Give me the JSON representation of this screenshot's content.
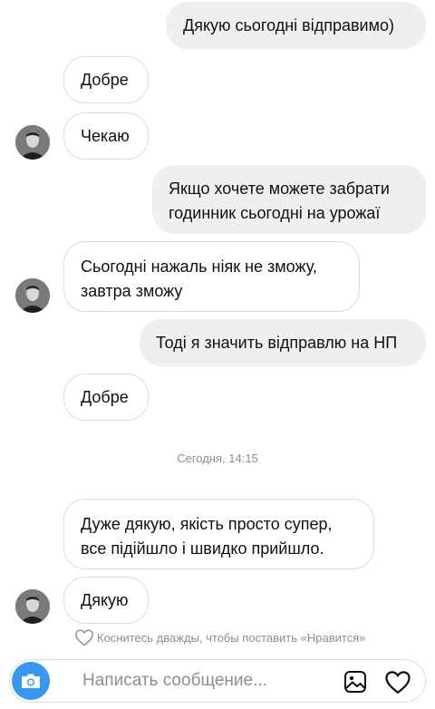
{
  "messages": [
    {
      "side": "out",
      "text": "Дякую сьогодні відправимо)"
    },
    {
      "side": "in",
      "text": "Добре"
    },
    {
      "side": "in",
      "text": "Чекаю"
    },
    {
      "side": "out",
      "lines": [
        "Якщо хочете можете забрати",
        "годинник сьогодні на урожаї"
      ]
    },
    {
      "side": "in",
      "lines": [
        "Сьогодні нажаль ніяк не зможу,",
        "завтра зможу"
      ]
    },
    {
      "side": "out",
      "text": "Тоді я значить відправлю на НП"
    },
    {
      "side": "in",
      "text": "Добре"
    },
    {
      "side": "in",
      "lines": [
        "Дуже дякую,  якість просто супер,",
        "все підійшло і швидко прийшло."
      ]
    },
    {
      "side": "in",
      "text": "Дякую"
    }
  ],
  "timestamp": "Сегодня, 14:15",
  "like_hint": "Коснитесь дважды, чтобы поставить «Нравится»",
  "composer": {
    "placeholder": "Написать сообщение...",
    "value": ""
  },
  "colors": {
    "accent": "#3897f0",
    "outgoing_bubble": "#efefef",
    "incoming_border": "#dcdcdc",
    "muted_text": "#8e8e8e"
  },
  "icons": [
    "camera-icon",
    "gallery-icon",
    "heart-icon",
    "heart-outline-icon"
  ]
}
